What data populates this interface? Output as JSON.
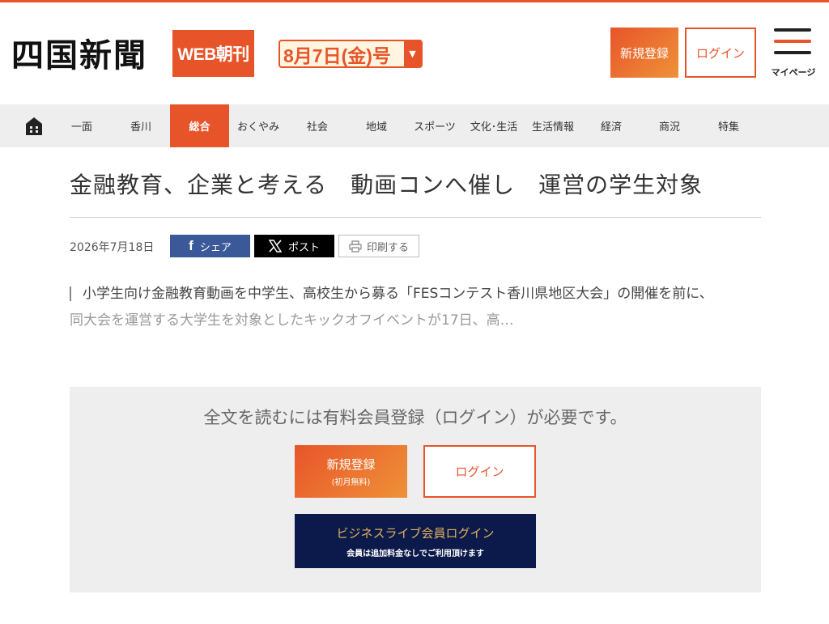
{
  "colors": {
    "accent": "#e8542a",
    "accent_light": "#ee9238",
    "nav_bg": "#eeeeee",
    "business_bg": "#0b1a4a",
    "business_text": "#e3b15e",
    "facebook": "#3b5998",
    "x": "#000000",
    "burger_line_1": "#222222",
    "burger_line_2": "#e8542a",
    "burger_line_3": "#222222"
  },
  "header": {
    "logo": "四国新聞",
    "edition": "WEB朝刊",
    "issue_date": "8月7日(金)号",
    "register_label": "新規登録",
    "login_label": "ログイン",
    "mypage_label": "マイページ"
  },
  "nav": {
    "home_icon": "home-icon",
    "items": [
      {
        "label": "一面",
        "active": false
      },
      {
        "label": "香川",
        "active": false
      },
      {
        "label": "総合",
        "active": true
      },
      {
        "label": "おくやみ",
        "active": false
      },
      {
        "label": "社会",
        "active": false
      },
      {
        "label": "地域",
        "active": false
      },
      {
        "label": "スポーツ",
        "active": false
      },
      {
        "label": "文化･生活",
        "active": false
      },
      {
        "label": "生活情報",
        "active": false
      },
      {
        "label": "経済",
        "active": false
      },
      {
        "label": "商況",
        "active": false
      },
      {
        "label": "特集",
        "active": false
      }
    ]
  },
  "article": {
    "title": "金融教育、企業と考える　動画コンへ催し　運営の学生対象",
    "date": "2026年7月18日",
    "share_facebook": "シェア",
    "share_x": "ポスト",
    "print": "印刷する",
    "lede_line1": "小学生向け金融教育動画を中学生、高校生から募る「FESコンテスト香川県地区大会」の開催を前に、",
    "lede_line2": "同大会を運営する大学生を対象としたキックオフイベントが17日、高…"
  },
  "paywall": {
    "message": "全文を読むには有料会員登録（ログイン）が必要です。",
    "register_label": "新規登録",
    "register_sub": "(初月無料)",
    "login_label": "ログイン",
    "business_label": "ビジネスライブ会員ログイン",
    "business_sub": "会員は追加料金なしでご利用頂けます"
  }
}
